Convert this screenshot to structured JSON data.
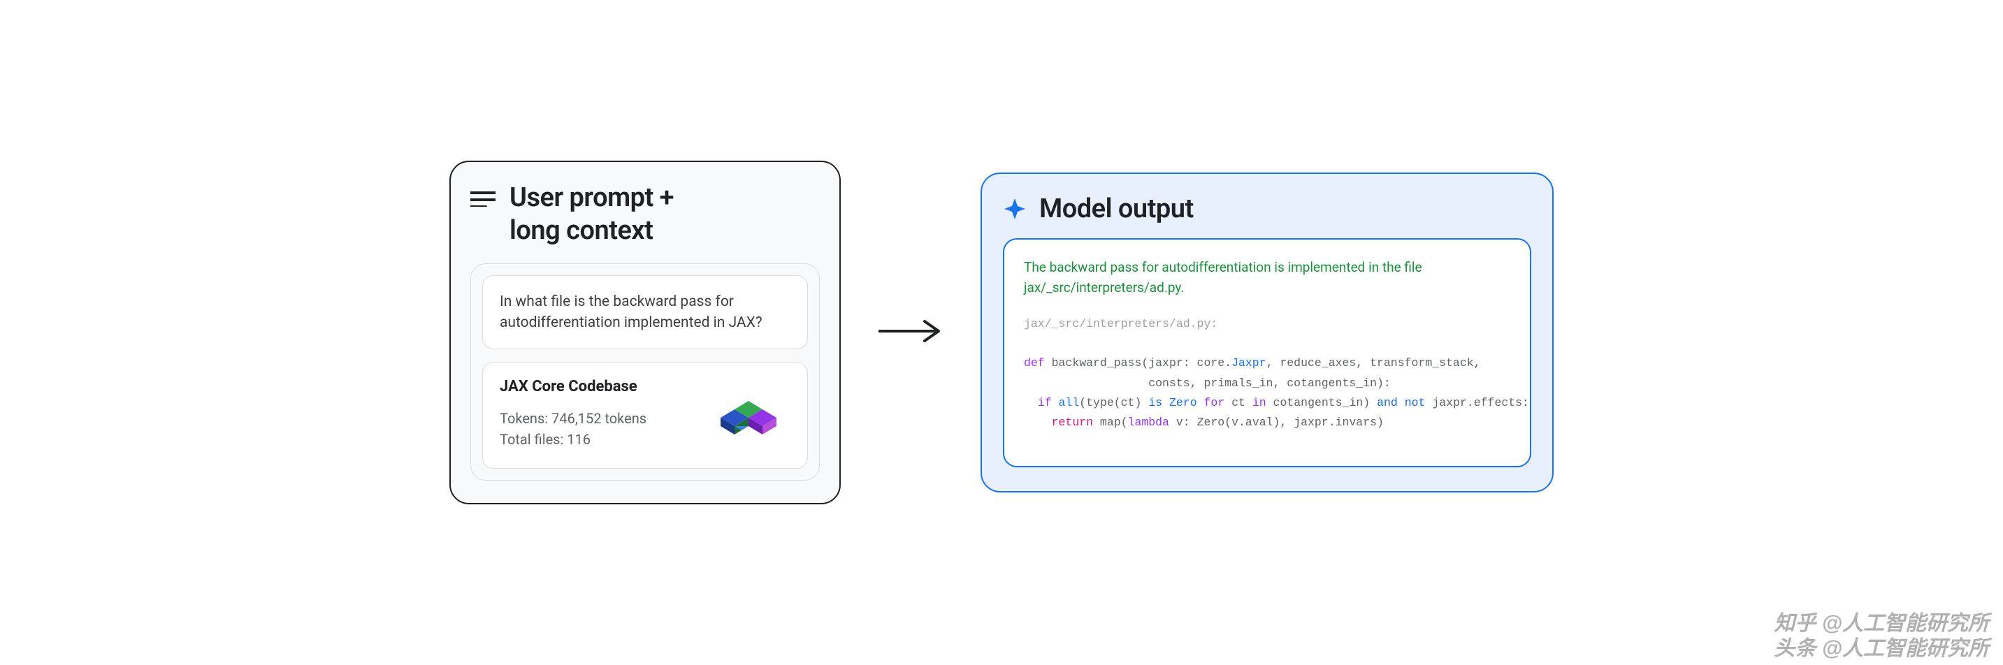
{
  "left": {
    "title_line1": "User prompt +",
    "title_line2": "long context",
    "prompt_text": "In what file is the backward pass for autodifferentiation implemented in JAX?",
    "codebase": {
      "title": "JAX Core Codebase",
      "tokens_label": "Tokens: 746,152 tokens",
      "files_label": "Total files: 116"
    }
  },
  "right": {
    "title": "Model output",
    "answer": "The backward pass for autodifferentiation is implemented in the file jax/_src/interpreters/ad.py.",
    "code_path": "jax/_src/interpreters/ad.py:",
    "code": {
      "def": "def",
      "fn_sig_1": " backward_pass(jaxpr: core.",
      "jaxpr_type": "Jaxpr",
      "fn_sig_2": ", reduce_axes, transform_stack,",
      "fn_sig_3": "                  consts, primals_in, cotangents_in):",
      "if": "if",
      "all": "all",
      "paren_open": "(type(ct) ",
      "is": "is",
      "zero1": " Zero ",
      "for": "for",
      "ct_in": " ct ",
      "in": "in",
      "cot_in": " cotangents_in) ",
      "and": "and",
      "not": " not",
      "effects": " jaxpr.effects:",
      "return": "return",
      "map_open": " map(",
      "lambda": "lambda",
      "lambda_body": " v: Zero(v.aval), jaxpr.invars)"
    }
  },
  "watermark": {
    "line1": "知乎 @人工智能研究所",
    "line2": "头条 @人工智能研究所"
  }
}
